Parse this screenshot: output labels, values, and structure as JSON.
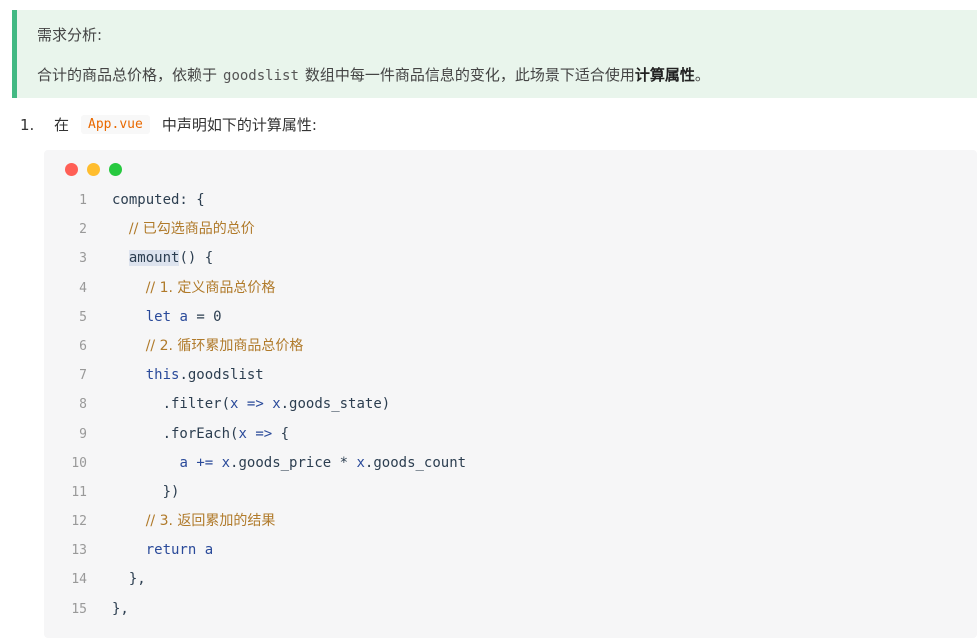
{
  "tip": {
    "title": "需求分析:",
    "body_prefix": "合计的商品总价格，依赖于",
    "body_code": "goodslist",
    "body_middle": "数组中每一件商品信息的变化，此场景下适合使用",
    "body_bold": "计算属性",
    "body_suffix": "。"
  },
  "step": {
    "number": "1.",
    "prefix": "在",
    "file": "App.vue",
    "suffix": "中声明如下的计算属性:"
  },
  "code": {
    "window_dots": [
      "#ff5f56",
      "#ffbd2e",
      "#27c93f"
    ],
    "lines": [
      {
        "n": "1",
        "text": "computed: {"
      },
      {
        "n": "2",
        "text": "  // 已勾选商品的总价"
      },
      {
        "n": "3",
        "text": "  amount() {"
      },
      {
        "n": "4",
        "text": "    // 1. 定义商品总价格"
      },
      {
        "n": "5",
        "text": "    let a = 0"
      },
      {
        "n": "6",
        "text": "    // 2. 循环累加商品总价格"
      },
      {
        "n": "7",
        "text": "    this.goodslist"
      },
      {
        "n": "8",
        "text": "      .filter(x => x.goods_state)"
      },
      {
        "n": "9",
        "text": "      .forEach(x => {"
      },
      {
        "n": "10",
        "text": "        a += x.goods_price * x.goods_count"
      },
      {
        "n": "11",
        "text": "      })"
      },
      {
        "n": "12",
        "text": "    // 3. 返回累加的结果"
      },
      {
        "n": "13",
        "text": "    return a"
      },
      {
        "n": "14",
        "text": "  },"
      },
      {
        "n": "15",
        "text": "},"
      }
    ]
  },
  "colors": {
    "tip_background": "#e9f5ec",
    "tip_border": "#42b983",
    "inline_code": "#e96900",
    "comment": "#b07a2a",
    "keyword": "#2a4a9a"
  }
}
